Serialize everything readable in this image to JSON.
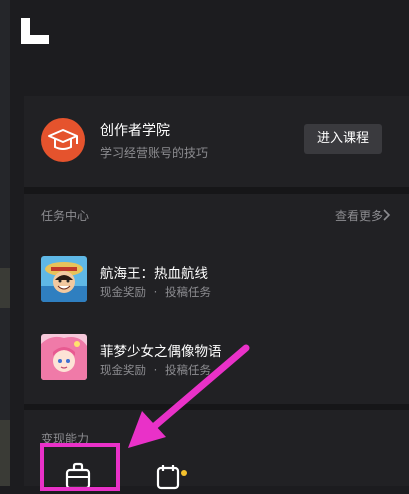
{
  "academy": {
    "title": "创作者学院",
    "subtitle": "学习经营账号的技巧",
    "button": "进入课程"
  },
  "tasks": {
    "title": "任务中心",
    "more": "查看更多",
    "items": [
      {
        "title": "航海王：热血航线",
        "reward": "现金奖励",
        "separator": "·",
        "type": "投稿任务"
      },
      {
        "title": "菲梦少女之偶像物语",
        "reward": "现金奖励",
        "separator": "·",
        "type": "投稿任务"
      }
    ]
  },
  "monetize": {
    "title": "变现能力"
  },
  "colors": {
    "accent_orange": "#e5532d",
    "annotation_pink": "#e931c8",
    "dot_yellow": "#f4c12d"
  },
  "icons": [
    "app-logo-icon",
    "graduation-cap-icon",
    "chevron-right-icon",
    "briefcase-icon",
    "calendar-icon"
  ]
}
